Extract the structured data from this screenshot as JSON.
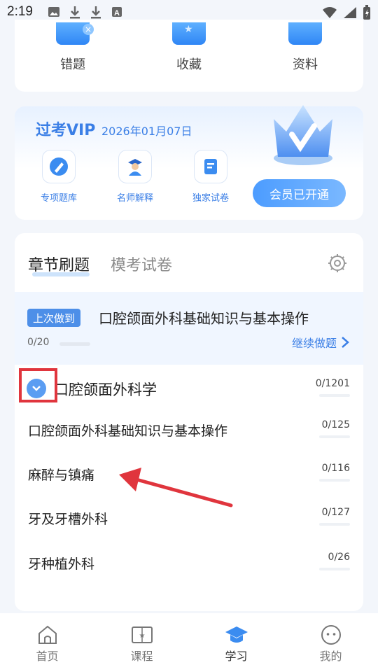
{
  "status_bar": {
    "time": "2:19"
  },
  "quick_links": [
    {
      "label": "错题",
      "icon": "wrong-questions-icon"
    },
    {
      "label": "收藏",
      "icon": "favorites-icon"
    },
    {
      "label": "资料",
      "icon": "materials-icon"
    }
  ],
  "vip": {
    "title": "过考VIP",
    "expiry_date": "2026年01月07日",
    "features": [
      {
        "label": "专项题库",
        "icon": "pen-icon"
      },
      {
        "label": "名师解释",
        "icon": "teacher-icon"
      },
      {
        "label": "独家试卷",
        "icon": "exam-paper-icon"
      }
    ],
    "button_label": "会员已开通"
  },
  "tabs": {
    "active": "章节刷题",
    "inactive": "模考试卷"
  },
  "last_session": {
    "badge": "上次做到",
    "title": "口腔颌面外科基础知识与基本操作",
    "progress": "0/20",
    "progress_fraction": 0,
    "continue_label": "继续做题"
  },
  "chapters": [
    {
      "label": "口腔颌面外科学",
      "count": "0/1201",
      "fraction": 0
    },
    {
      "label": "口腔颌面外科基础知识与基本操作",
      "count": "0/125",
      "fraction": 0
    },
    {
      "label": "麻醉与镇痛",
      "count": "0/116",
      "fraction": 0
    },
    {
      "label": "牙及牙槽外科",
      "count": "0/127",
      "fraction": 0
    },
    {
      "label": "牙种植外科",
      "count": "0/26",
      "fraction": 0
    }
  ],
  "bottom_nav": [
    {
      "label": "首页",
      "icon": "home-icon"
    },
    {
      "label": "课程",
      "icon": "course-book-icon"
    },
    {
      "label": "学习",
      "icon": "graduation-cap-icon",
      "active": true
    },
    {
      "label": "我的",
      "icon": "profile-face-icon"
    }
  ],
  "colors": {
    "accent": "#3b7fe6",
    "annotation": "#e0353d"
  }
}
